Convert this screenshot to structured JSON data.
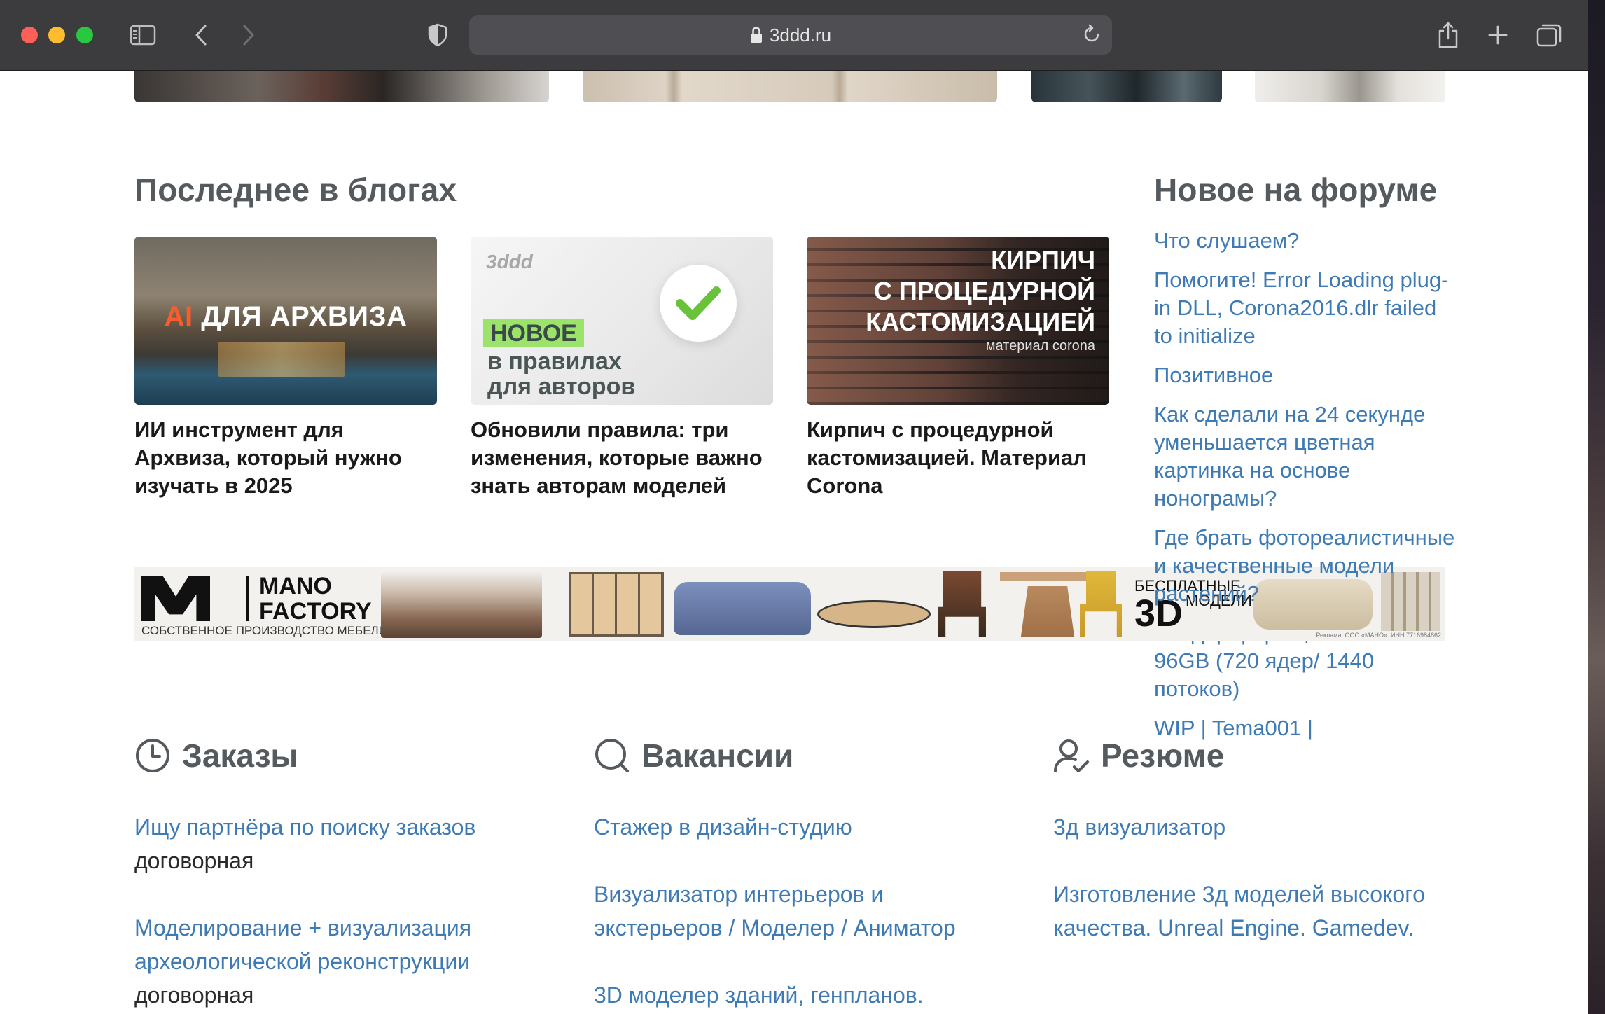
{
  "browser": {
    "url": "3ddd.ru"
  },
  "blogs": {
    "title": "Последнее в блогах",
    "items": [
      {
        "title": "ИИ инструмент для Архвиза, который нужно изучать в 2025",
        "img_text_accent": "AI",
        "img_text": "ДЛЯ АРХВИЗА"
      },
      {
        "title": "Обновили правила: три изменения, которые важно знать авторам моделей",
        "img_logo": "3ddd",
        "img_line1": "НОВОЕ",
        "img_line2": "в правилах",
        "img_line3": "для авторов"
      },
      {
        "title": "Кирпич с процедурной кастомизацией. Материал Corona",
        "img_line1": "КИРПИЧ",
        "img_line2": "С ПРОЦЕДУРНОЙ",
        "img_line3": "КАСТОМИЗАЦИЕЙ",
        "img_line4": "материал corona"
      }
    ]
  },
  "forum": {
    "title": "Новое на форуме",
    "items": [
      "Что слушаем?",
      "Помогите! Error Loading plug-in DLL, Corona2016.dlr failed to initialize",
      "Позитивное",
      "Как сделали на 24 секунде уменьшается цветная картинка на основе нонограмы?",
      "Где брать фотореалистичные и качественные модели растений?",
      "Рендер ферма, 15 машин по 96GB (720 ядер/ 1440 потоков)",
      "WIP | Tema001 |"
    ]
  },
  "banner": {
    "brand_line1": "MANO",
    "brand_line2": "FACTORY",
    "brand_sub": "СОБСТВЕННОЕ ПРОИЗВОДСТВО МЕБЕЛИ",
    "promo_line1": "БЕСПЛАТНЫЕ",
    "promo_big": "3D",
    "promo_line2": "МОДЕЛИ",
    "disclaimer": "Реклама. ООО «МАНО». ИНН 7716984862"
  },
  "orders": {
    "title": "Заказы",
    "items": [
      {
        "title": "Ищу партнёра по поиску заказов",
        "price": "договорная"
      },
      {
        "title": "Моделирование + визуализация археологической реконструкции",
        "price": "договорная"
      }
    ]
  },
  "vacancies": {
    "title": "Вакансии",
    "items": [
      "Стажер в дизайн-студию",
      "Визуализатор интерьеров и экстерьеров / Моделер / Аниматор",
      "3D моделер зданий, генпланов."
    ]
  },
  "resumes": {
    "title": "Резюме",
    "items": [
      "3д визуализатор",
      "Изготовление 3д моделей высокого качества. Unreal Engine. Gamedev."
    ]
  }
}
